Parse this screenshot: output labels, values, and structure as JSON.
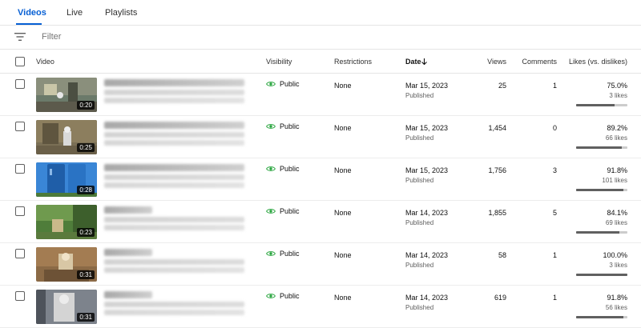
{
  "tabs": [
    {
      "label": "Videos",
      "active": true
    },
    {
      "label": "Live",
      "active": false
    },
    {
      "label": "Playlists",
      "active": false
    }
  ],
  "filter": {
    "placeholder": "Filter",
    "icon": "filter-icon"
  },
  "columns": {
    "video": "Video",
    "visibility": "Visibility",
    "restrictions": "Restrictions",
    "date": "Date",
    "views": "Views",
    "comments": "Comments",
    "likes": "Likes (vs. dislikes)"
  },
  "colors": {
    "accent": "#065fd4",
    "public_icon": "#2ba640",
    "bar_fill": "#606060",
    "bar_track": "#cccccc"
  },
  "rows": [
    {
      "duration": "0:20",
      "visibility": "Public",
      "restrictions": "None",
      "date": "Mar 15, 2023",
      "status": "Published",
      "views": "25",
      "comments": "1",
      "likes_pct": "75.0%",
      "likes_count": "3 likes",
      "ratio": 0.75
    },
    {
      "duration": "0:25",
      "visibility": "Public",
      "restrictions": "None",
      "date": "Mar 15, 2023",
      "status": "Published",
      "views": "1,454",
      "comments": "0",
      "likes_pct": "89.2%",
      "likes_count": "66 likes",
      "ratio": 0.892
    },
    {
      "duration": "0:28",
      "visibility": "Public",
      "restrictions": "None",
      "date": "Mar 15, 2023",
      "status": "Published",
      "views": "1,756",
      "comments": "3",
      "likes_pct": "91.8%",
      "likes_count": "101 likes",
      "ratio": 0.918
    },
    {
      "duration": "0:23",
      "visibility": "Public",
      "restrictions": "None",
      "date": "Mar 14, 2023",
      "status": "Published",
      "views": "1,855",
      "comments": "5",
      "likes_pct": "84.1%",
      "likes_count": "69 likes",
      "ratio": 0.841
    },
    {
      "duration": "0:31",
      "visibility": "Public",
      "restrictions": "None",
      "date": "Mar 14, 2023",
      "status": "Published",
      "views": "58",
      "comments": "1",
      "likes_pct": "100.0%",
      "likes_count": "3 likes",
      "ratio": 1.0
    },
    {
      "duration": "0:31",
      "visibility": "Public",
      "restrictions": "None",
      "date": "Mar 14, 2023",
      "status": "Published",
      "views": "619",
      "comments": "1",
      "likes_pct": "91.8%",
      "likes_count": "56 likes",
      "ratio": 0.918
    }
  ]
}
